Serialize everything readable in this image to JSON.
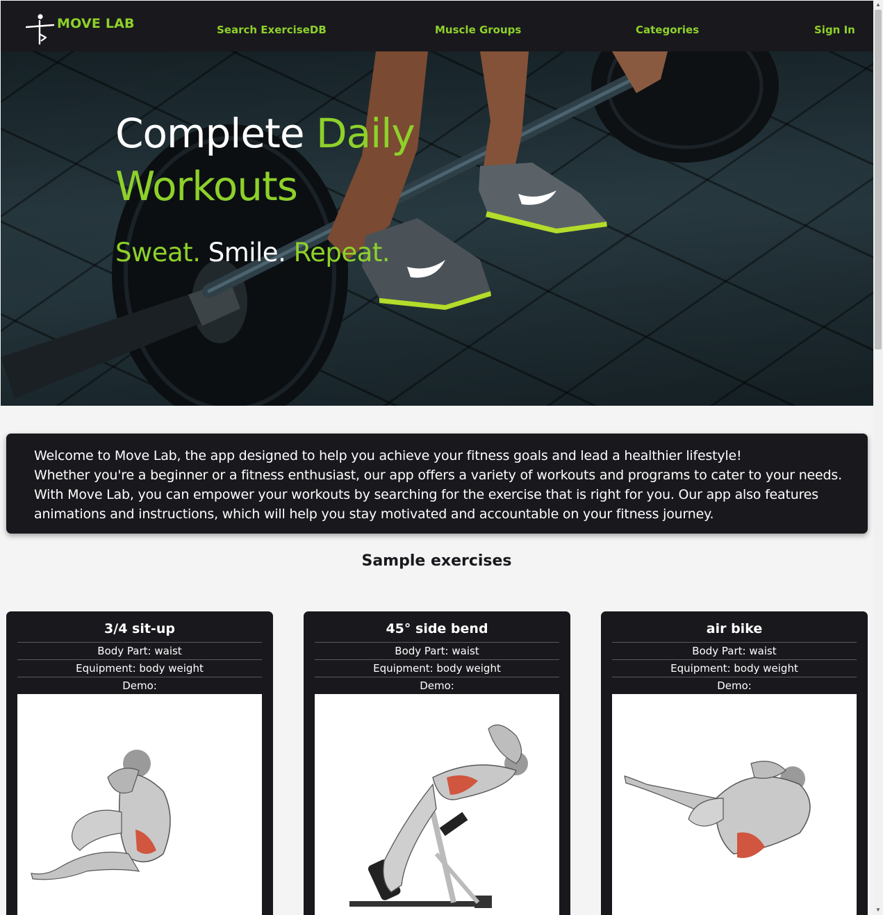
{
  "nav": {
    "brand": "MOVE LAB",
    "links": [
      "Search ExerciseDB",
      "Muscle Groups",
      "Categories",
      "Sign In"
    ]
  },
  "hero": {
    "title_white": "Complete ",
    "title_green": "Daily Workouts",
    "tagline": {
      "sweat": "Sweat.",
      "smile": " Smile.",
      "repeat": " Repeat."
    }
  },
  "welcome": {
    "line1": "Welcome to Move Lab, the app designed to help you achieve your fitness goals and lead a healthier lifestyle!",
    "line2": "Whether you're a beginner or a fitness enthusiast, our app offers a variety of workouts and programs to cater to your needs. With Move Lab, you can empower your workouts by searching for the exercise that is right for you. Our app also features animations and instructions, which will help you stay motivated and accountable on your fitness journey."
  },
  "samples": {
    "title": "Sample exercises",
    "cards": [
      {
        "name": "3/4 sit-up",
        "body_part": "Body Part: waist",
        "equipment": "Equipment: body weight",
        "demo": "Demo:"
      },
      {
        "name": "45° side bend",
        "body_part": "Body Part: waist",
        "equipment": "Equipment: body weight",
        "demo": "Demo:"
      },
      {
        "name": "air bike",
        "body_part": "Body Part: waist",
        "equipment": "Equipment: body weight",
        "demo": "Demo:"
      }
    ]
  },
  "colors": {
    "accent": "#8ed12a",
    "dark": "#19181d",
    "page_bg": "#f4f4f4"
  }
}
